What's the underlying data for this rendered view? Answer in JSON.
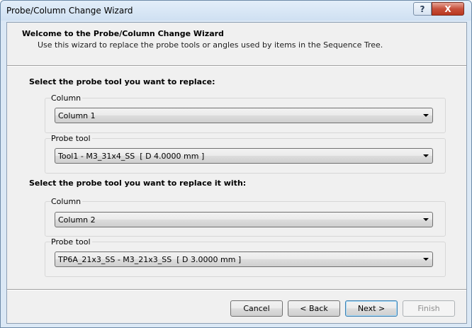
{
  "window": {
    "title": "Probe/Column Change Wizard",
    "help_glyph": "?",
    "close_glyph": "X"
  },
  "header": {
    "title": "Welcome to the Probe/Column Change Wizard",
    "subtitle": "Use this wizard to replace the probe tools or angles used by items in the Sequence Tree."
  },
  "replace_from": {
    "heading": "Select the probe tool you want to replace:",
    "column_label": "Column",
    "column_value": "Column 1",
    "probe_label": "Probe tool",
    "probe_value": "Tool1 - M3_31x4_SS  [ D 4.0000 mm ]"
  },
  "replace_with": {
    "heading": "Select the probe tool you want to replace it with:",
    "column_label": "Column",
    "column_value": "Column 2",
    "probe_label": "Probe tool",
    "probe_value": "TP6A_21x3_SS - M3_21x3_SS  [ D 3.0000 mm ]"
  },
  "buttons": {
    "cancel": "Cancel",
    "back": "< Back",
    "next": "Next >",
    "finish": "Finish"
  }
}
